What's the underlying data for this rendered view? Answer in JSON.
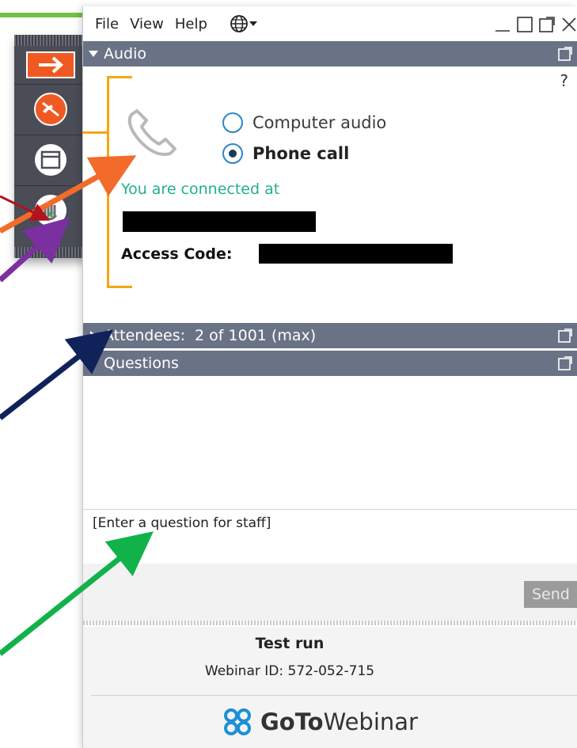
{
  "menu": {
    "file": "File",
    "view": "View",
    "help": "Help"
  },
  "sections": {
    "audio": {
      "title": "Audio"
    },
    "attendees": {
      "title": "Attendees:",
      "count": "2 of 1001 (max)"
    },
    "questions": {
      "title": "Questions"
    }
  },
  "audio": {
    "help": "?",
    "options": [
      {
        "label": "Computer audio",
        "selected": false
      },
      {
        "label": "Phone call",
        "selected": true
      }
    ],
    "connected_text": "You are connected at",
    "access_code_label": "Access Code:"
  },
  "questions": {
    "input_placeholder": "[Enter a question for staff]",
    "send_label": "Send"
  },
  "footer": {
    "title": "Test run",
    "webinar_id": "Webinar ID: 572-052-715",
    "brand_goto": "GoTo",
    "brand_webinar": "Webinar"
  },
  "colors": {
    "header": "#6a7385",
    "bracket": "#f3a712",
    "connected": "#22b08d",
    "arrow_orange": "#f26b2a",
    "arrow_darkred": "#b0141e",
    "arrow_purple": "#7b2fa0",
    "arrow_navy": "#10225a",
    "arrow_green": "#12b24a"
  }
}
